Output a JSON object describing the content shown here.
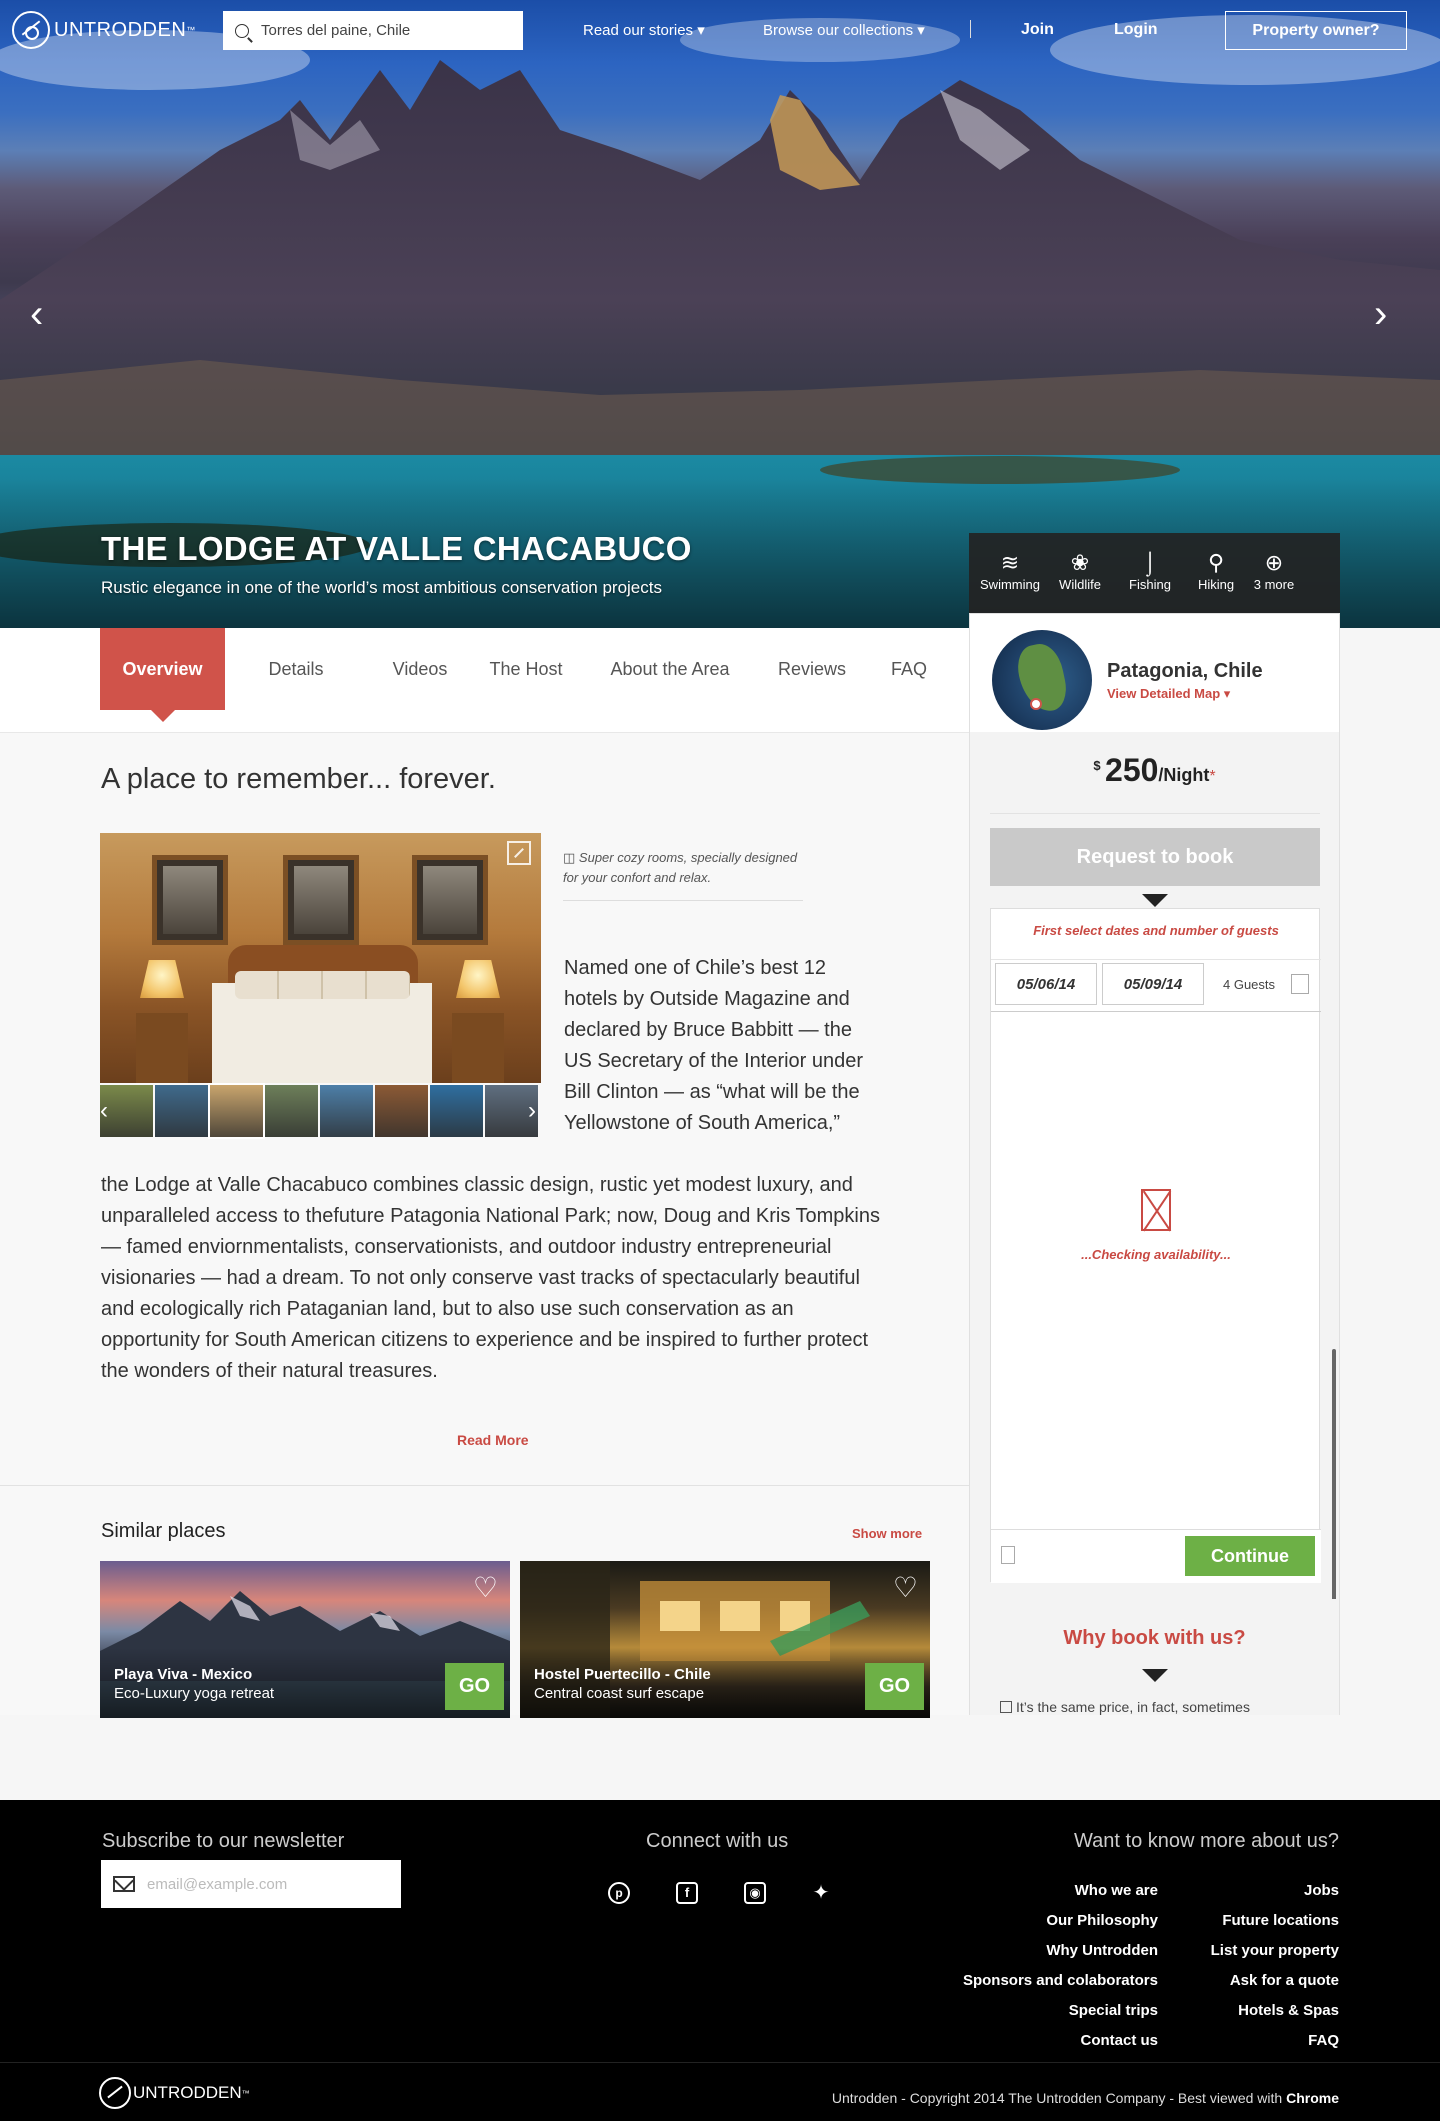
{
  "brand": {
    "name": "UNTRODDEN",
    "tm": "™"
  },
  "search": {
    "value": "Torres del paine, Chile",
    "placeholder": ""
  },
  "nav": {
    "stories": "Read our stories ▾",
    "collections": "Browse our collections ▾",
    "join": "Join",
    "login": "Login",
    "owner": "Property owner?"
  },
  "hero": {
    "title": "THE LODGE AT VALLE CHACABUCO",
    "subtitle": "Rustic elegance in one of the world’s most ambitious conservation projects",
    "prev_glyph": "‹",
    "next_glyph": "›"
  },
  "amenities": [
    {
      "label": "Swimming",
      "glyph": "≋",
      "icon": "swimming-icon"
    },
    {
      "label": "Wildlife",
      "glyph": "❀",
      "icon": "paw-icon"
    },
    {
      "label": "Fishing",
      "glyph": "⌡",
      "icon": "fishing-hook-icon"
    },
    {
      "label": "Hiking",
      "glyph": "⚲",
      "icon": "hiker-icon"
    },
    {
      "label": "3 more",
      "glyph": "⊕",
      "icon": "plus-circle-icon"
    }
  ],
  "tabs": [
    {
      "label": "Overview",
      "active": true
    },
    {
      "label": "Details"
    },
    {
      "label": "Videos"
    },
    {
      "label": "The Host"
    },
    {
      "label": "About the Area"
    },
    {
      "label": "Reviews"
    },
    {
      "label": "FAQ"
    }
  ],
  "overview": {
    "heading": "A place to remember... forever.",
    "caption_icon": "◫",
    "caption": "Super cozy rooms, specially designed for your confort and relax.",
    "intro": "Named one of Chile’s best 12 hotels by Outside Magazine and declared by Bruce Babbitt — the US Secretary of the Interior under Bill Clinton — as “what will be the Yellowstone of South America,”",
    "body": "the Lodge at Valle Chacabuco combines classic design, rustic yet modest luxury, and unparalleled access to thefuture Patagonia National Park; now, Doug and Kris Tompkins — famed enviornmentalists, conservationists, and outdoor industry entrepreneurial visionaries — had a dream. To not only conserve vast tracks of spectacularly beautiful and ecologically rich Pataganian land, but to also use such conservation as an opportunity for South American citizens to experience and be inspired to further protect the wonders of their natural treasures.",
    "read_more": "Read More",
    "thumb_colors": [
      "#7b8a4a",
      "#3f6a8c",
      "#c9a56d",
      "#6d7f5a",
      "#4d7fa8",
      "#8c5a35",
      "#2f6fa0",
      "#5f6f80"
    ]
  },
  "booking": {
    "location": "Patagonia, Chile",
    "map_link": "View Detailed Map ▾",
    "currency": "$",
    "price": "250",
    "per": "/Night",
    "asterisk": "*",
    "request": "Request to book",
    "hint": "First select dates and number of guests",
    "checkin": "05/06/14",
    "checkout": "05/09/14",
    "guests": "4 Guests",
    "loading": "...Checking availability...",
    "continue": "Continue",
    "why": "Why book with us?",
    "why_line": "It’s the same price, in fact, sometimes"
  },
  "similar": {
    "title": "Similar places",
    "show_more": "Show more",
    "cards": [
      {
        "name": "Playa Viva - Mexico",
        "sub": "Eco-Luxury yoga retreat",
        "go": "GO",
        "heart": "♡"
      },
      {
        "name": "Hostel Puertecillo - Chile",
        "sub": "Central coast surf escape",
        "go": "GO",
        "heart": "♡"
      }
    ]
  },
  "footer": {
    "newsletter_title": "Subscribe to our newsletter",
    "newsletter_placeholder": "email@example.com",
    "connect_title": "Connect with us",
    "social": [
      {
        "glyph": "p",
        "icon": "pinterest-icon"
      },
      {
        "glyph": "f",
        "icon": "facebook-icon"
      },
      {
        "glyph": "◉",
        "icon": "instagram-icon"
      },
      {
        "glyph": "✦",
        "icon": "twitter-icon"
      }
    ],
    "more_title": "Want to know more about us?",
    "links_col1": [
      "Who we are",
      "Our Philosophy",
      "Why Untrodden",
      "Sponsors and colaborators",
      "Special trips",
      "Contact us"
    ],
    "links_col2": [
      "Jobs",
      "Future locations",
      "List your property",
      "Ask for a quote",
      "Hotels & Spas",
      "FAQ"
    ],
    "copyright": "Untrodden - Copyright 2014 The Untrodden Company - Best viewed with",
    "browser": "Chrome"
  }
}
